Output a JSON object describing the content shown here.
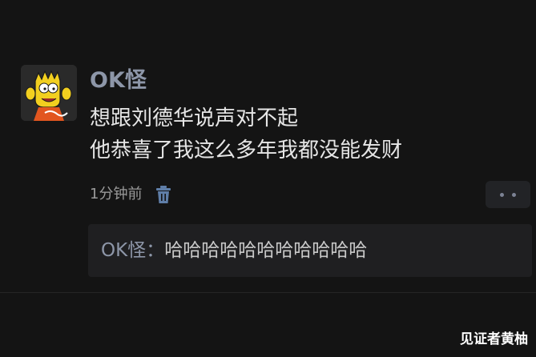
{
  "post": {
    "username": "OK怪",
    "content_lines": [
      "想跟刘德华说声对不起",
      "他恭喜了我这么多年我都没能发财"
    ],
    "timestamp": "1分钟前",
    "delete_icon": "trash-icon",
    "more_icon": "more-dots-icon"
  },
  "reply": {
    "author": "OK怪",
    "separator": "：",
    "text": "哈哈哈哈哈哈哈哈哈哈哈"
  },
  "watermark": "见证者黄柚",
  "colors": {
    "background": "#141414",
    "username": "#8d96a8",
    "content": "#e6e6e6",
    "timestamp": "#9a9a9a",
    "reply_background": "#1f1f21",
    "icon": "#5f7ea8"
  }
}
